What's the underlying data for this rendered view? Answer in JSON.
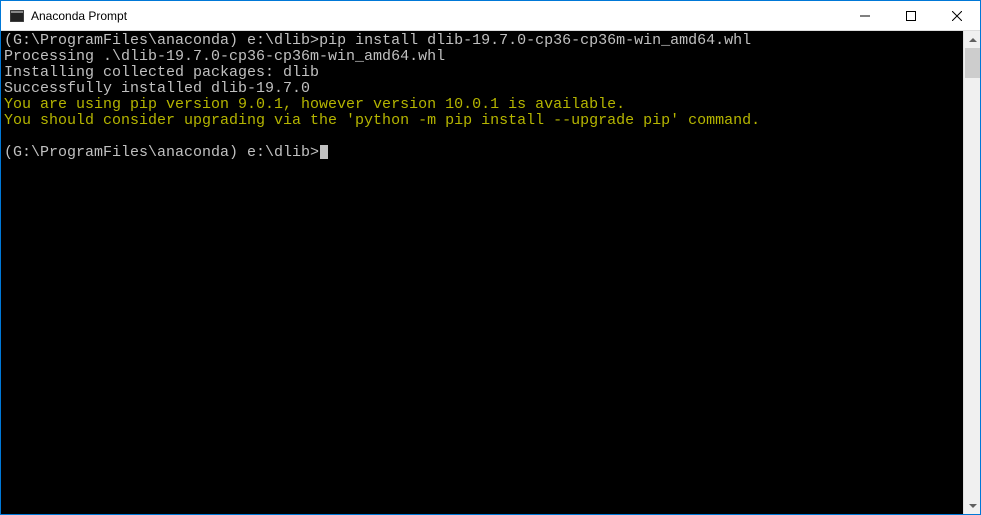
{
  "window": {
    "title": "Anaconda Prompt"
  },
  "terminal": {
    "line1_prompt": "(G:\\ProgramFiles\\anaconda) e:\\dlib>",
    "line1_cmd": "pip install dlib-19.7.0-cp36-cp36m-win_amd64.whl",
    "line2": "Processing .\\dlib-19.7.0-cp36-cp36m-win_amd64.whl",
    "line3": "Installing collected packages: dlib",
    "line4": "Successfully installed dlib-19.7.0",
    "line5": "You are using pip version 9.0.1, however version 10.0.1 is available.",
    "line6": "You should consider upgrading via the 'python -m pip install --upgrade pip' command.",
    "line7_prompt": "(G:\\ProgramFiles\\anaconda) e:\\dlib>"
  }
}
